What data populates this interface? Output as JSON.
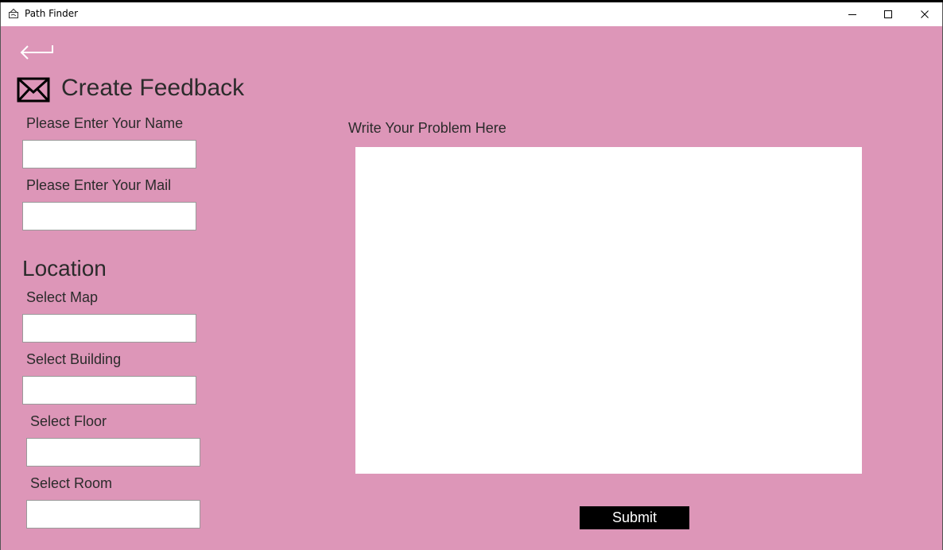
{
  "window": {
    "title": "Path Finder",
    "controls": [
      "minimize",
      "maximize",
      "close"
    ]
  },
  "header": {
    "back_icon": "back-arrow-icon",
    "mail_icon": "envelope-icon",
    "title": "Create Feedback"
  },
  "form": {
    "name_label": "Please Enter Your Name",
    "name_value": "",
    "mail_label": "Please Enter Your Mail",
    "mail_value": "",
    "location_title": "Location",
    "map_label": "Select Map",
    "map_value": "",
    "building_label": "Select Building",
    "building_value": "",
    "floor_label": "Select Floor",
    "floor_value": "",
    "room_label": "Select Room",
    "room_value": "",
    "problem_label": "Write Your Problem Here",
    "problem_value": "",
    "submit_label": "Submit"
  },
  "colors": {
    "background": "#dd96b8",
    "submit_bg": "#000000",
    "submit_text": "#ffffff"
  }
}
